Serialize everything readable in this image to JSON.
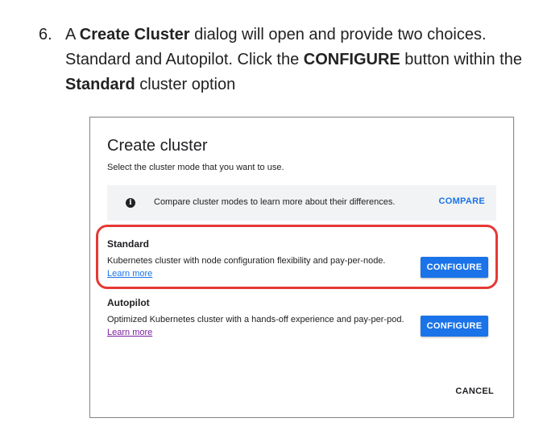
{
  "step": {
    "number": "6.",
    "parts": {
      "p1": "A ",
      "b1": "Create Cluster",
      "p2": " dialog will open and provide two choices. Standard and Autopilot. Click the ",
      "b2": "CONFIGURE",
      "p3": " button within the ",
      "b3": "Standard",
      "p4": " cluster option"
    }
  },
  "dialog": {
    "title": "Create cluster",
    "subtitle": "Select the cluster mode that you want to use.",
    "info": {
      "icon": "info-icon",
      "text": "Compare cluster modes to learn more about their differences.",
      "compare_label": "COMPARE"
    },
    "options": [
      {
        "title": "Standard",
        "description": "Kubernetes cluster with node configuration flexibility and pay-per-node.",
        "link": "Learn more",
        "button": "CONFIGURE"
      },
      {
        "title": "Autopilot",
        "description": "Optimized Kubernetes cluster with a hands-off experience and pay-per-pod.",
        "link": "Learn more",
        "button": "CONFIGURE"
      }
    ],
    "cancel_label": "CANCEL"
  },
  "colors": {
    "accent": "#1a73e8",
    "highlight": "#e53935",
    "visited_link": "#7b1fa2",
    "info_bg": "#f1f3f4"
  }
}
